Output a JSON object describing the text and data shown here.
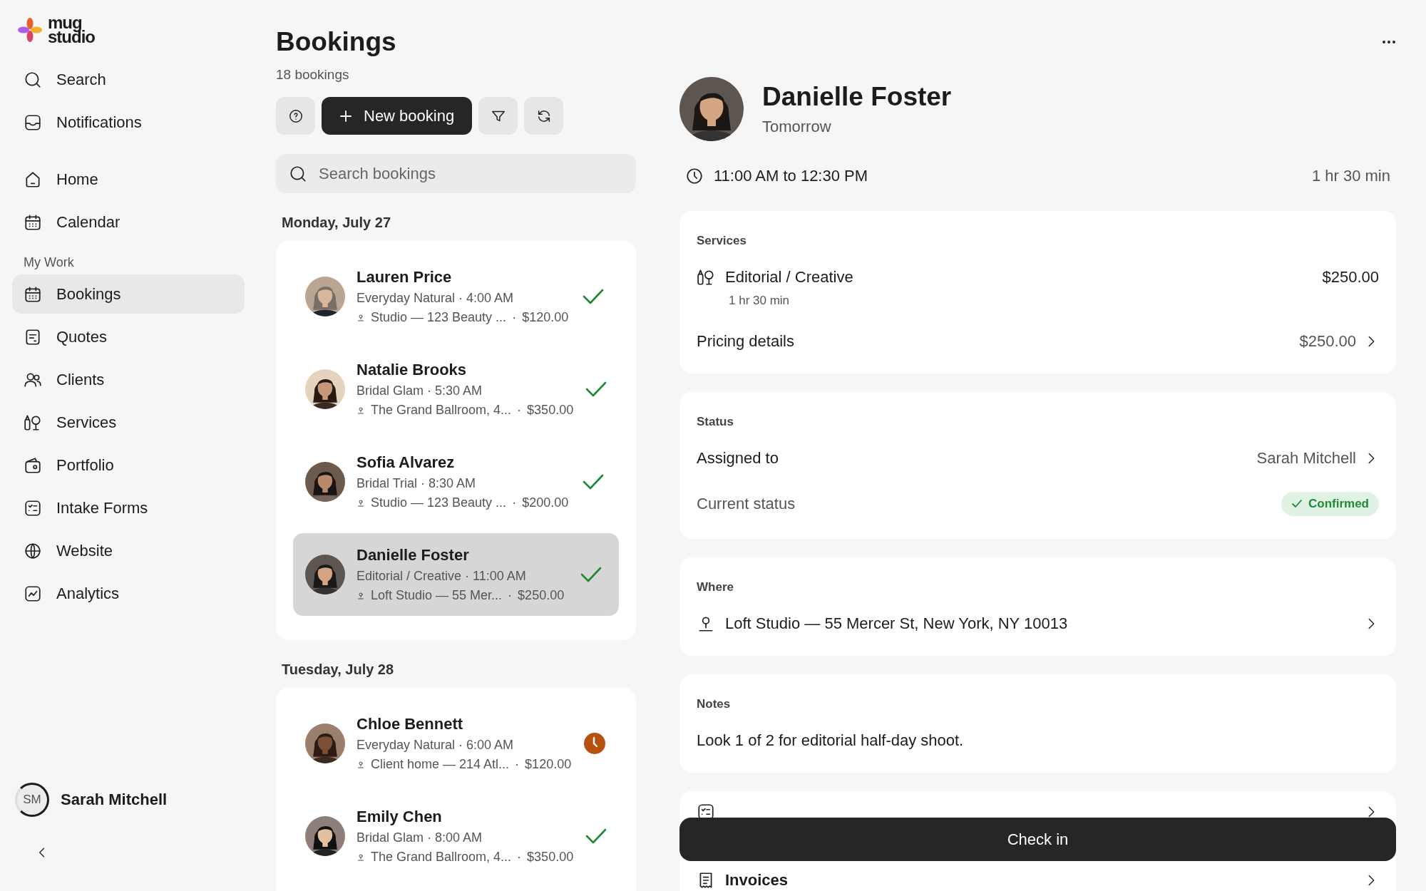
{
  "sidebar": {
    "logo": {
      "line1": "mug",
      "line2": "studio"
    },
    "top_items": [
      {
        "label": "Search",
        "selected": false
      },
      {
        "label": "Notifications",
        "selected": false
      }
    ],
    "main_items": [
      {
        "label": "Home",
        "selected": false
      },
      {
        "label": "Calendar",
        "selected": false
      }
    ],
    "section": "My Work",
    "work_items": [
      {
        "label": "Bookings",
        "selected": true
      },
      {
        "label": "Quotes",
        "selected": false
      },
      {
        "label": "Clients",
        "selected": false
      },
      {
        "label": "Services",
        "selected": false
      },
      {
        "label": "Portfolio",
        "selected": false
      },
      {
        "label": "Intake Forms",
        "selected": false
      },
      {
        "label": "Website",
        "selected": false
      },
      {
        "label": "Analytics",
        "selected": false
      }
    ],
    "user": {
      "initials": "SM",
      "name": "Sarah Mitchell"
    }
  },
  "list": {
    "title": "Bookings",
    "count": "18 bookings",
    "new_button": "New booking",
    "search": {
      "placeholder": "Search bookings"
    },
    "groups": [
      {
        "date": "Monday, July 27",
        "bookings": [
          {
            "name": "Lauren Price",
            "meta": "Everyday Natural · 4:00 AM",
            "location": "Studio — 123 Beauty ...",
            "sep": "·",
            "price": "$120.00",
            "kind": "check",
            "selected": false
          },
          {
            "name": "Natalie Brooks",
            "meta": "Bridal Glam · 5:30 AM",
            "location": "The Grand Ballroom, 4...",
            "sep": "·",
            "price": "$350.00",
            "kind": "check",
            "selected": false
          },
          {
            "name": "Sofia Alvarez",
            "meta": "Bridal Trial · 8:30 AM",
            "location": "Studio — 123 Beauty ...",
            "sep": "·",
            "price": "$200.00",
            "kind": "check",
            "selected": false
          },
          {
            "name": "Danielle Foster",
            "meta": "Editorial / Creative · 11:00 AM",
            "location": "Loft Studio — 55 Mer...",
            "sep": "·",
            "price": "$250.00",
            "kind": "check",
            "selected": true
          }
        ]
      },
      {
        "date": "Tuesday, July 28",
        "bookings": [
          {
            "name": "Chloe Bennett",
            "meta": "Everyday Natural · 6:00 AM",
            "location": "Client home — 214 Atl...",
            "sep": "·",
            "price": "$120.00",
            "kind": "clock",
            "selected": false
          },
          {
            "name": "Emily Chen",
            "meta": "Bridal Glam · 8:00 AM",
            "location": "The Grand Ballroom, 4...",
            "sep": "·",
            "price": "$350.00",
            "kind": "check",
            "selected": false
          }
        ]
      }
    ]
  },
  "detail": {
    "client": {
      "name": "Danielle Foster",
      "when": "Tomorrow"
    },
    "time": {
      "range": "11:00 AM to 12:30 PM",
      "duration": "1 hr 30 min"
    },
    "services": {
      "heading": "Services",
      "name": "Editorial / Creative",
      "duration": "1 hr 30 min",
      "price": "$250.00",
      "pricing_label": "Pricing details",
      "pricing_value": "$250.00"
    },
    "status": {
      "heading": "Status",
      "assigned_label": "Assigned to",
      "assigned_value": "Sarah Mitchell",
      "current_label": "Current status",
      "current_value": "Confirmed"
    },
    "where": {
      "heading": "Where",
      "address": "Loft Studio — 55 Mercer St, New York, NY 10013"
    },
    "notes": {
      "heading": "Notes",
      "text": "Look 1 of 2 for editorial half-day shoot."
    },
    "links": [
      {
        "label": "Invoices"
      }
    ],
    "check_in": "Check in"
  }
}
